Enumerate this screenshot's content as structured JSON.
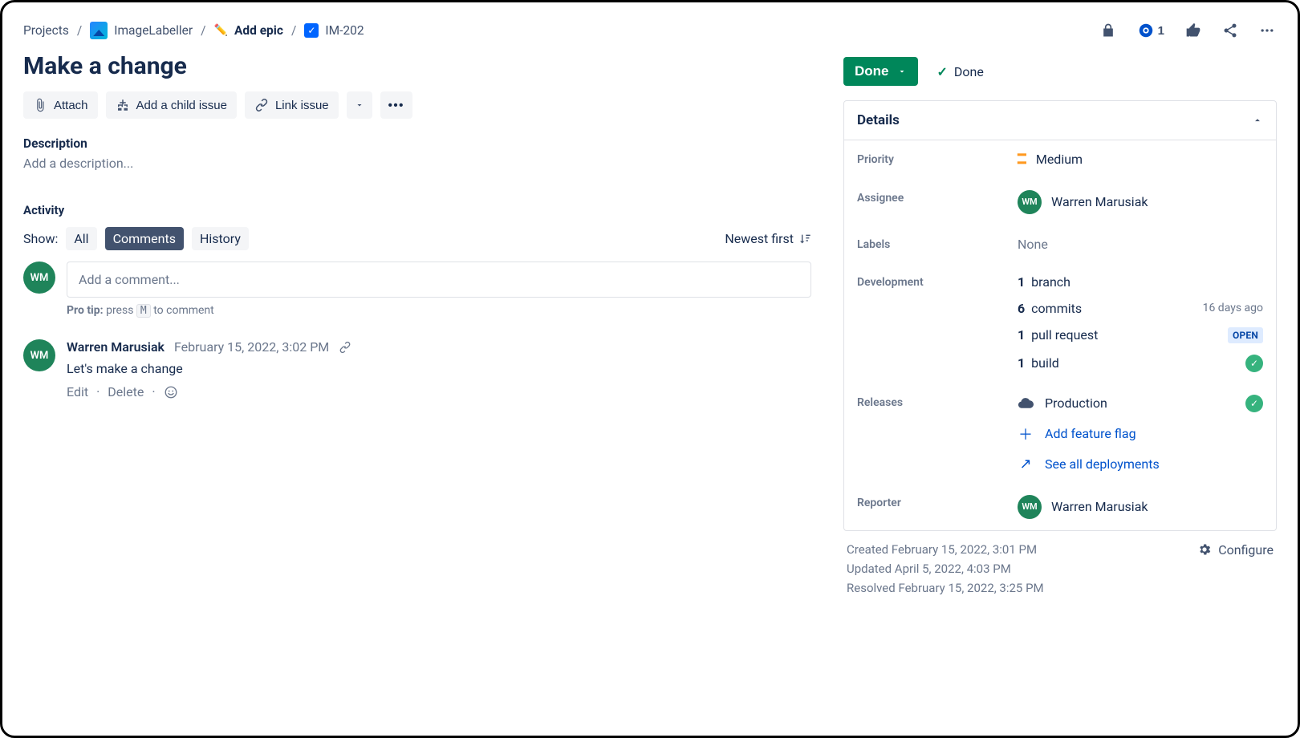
{
  "breadcrumbs": {
    "projects": "Projects",
    "project_name": "ImageLabeller",
    "add_epic": "Add epic",
    "issue_key": "IM-202"
  },
  "top_icons": {
    "watchers_count": "1"
  },
  "issue": {
    "title": "Make a change",
    "description_placeholder": "Add a description..."
  },
  "toolbar": {
    "attach": "Attach",
    "add_child": "Add a child issue",
    "link_issue": "Link issue"
  },
  "section_labels": {
    "description": "Description",
    "activity": "Activity"
  },
  "activity": {
    "show_label": "Show:",
    "tabs": {
      "all": "All",
      "comments": "Comments",
      "history": "History"
    },
    "sort": "Newest first",
    "comment_placeholder": "Add a comment...",
    "protip_label": "Pro tip:",
    "protip_press": "press",
    "protip_key": "M",
    "protip_rest": "to comment"
  },
  "comment": {
    "avatar_initials": "WM",
    "author": "Warren Marusiak",
    "timestamp": "February 15, 2022, 3:02 PM",
    "body": "Let's make a change",
    "edit": "Edit",
    "delete": "Delete"
  },
  "status": {
    "button": "Done",
    "resolved_label": "Done"
  },
  "details": {
    "header": "Details",
    "priority_label": "Priority",
    "priority_value": "Medium",
    "assignee_label": "Assignee",
    "assignee_value": "Warren Marusiak",
    "assignee_initials": "WM",
    "labels_label": "Labels",
    "labels_value": "None",
    "development_label": "Development",
    "dev": {
      "branch_n": "1",
      "branch_t": "branch",
      "commits_n": "6",
      "commits_t": "commits",
      "commits_ago": "16 days ago",
      "pr_n": "1",
      "pr_t": "pull request",
      "pr_badge": "OPEN",
      "build_n": "1",
      "build_t": "build"
    },
    "releases_label": "Releases",
    "releases": {
      "prod": "Production",
      "add_flag": "Add feature flag",
      "see_all": "See all deployments"
    },
    "reporter_label": "Reporter",
    "reporter_value": "Warren Marusiak",
    "reporter_initials": "WM"
  },
  "meta": {
    "created": "Created February 15, 2022, 3:01 PM",
    "updated": "Updated April 5, 2022, 4:03 PM",
    "resolved": "Resolved February 15, 2022, 3:25 PM",
    "configure": "Configure"
  }
}
